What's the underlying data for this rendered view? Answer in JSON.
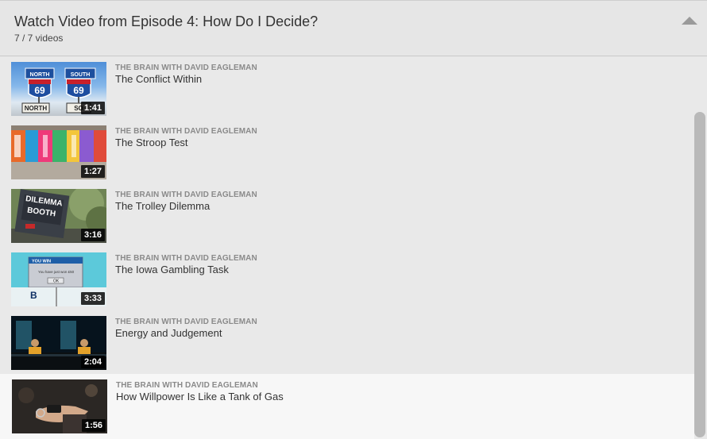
{
  "header": {
    "title": "Watch Video from Episode 4: How Do I Decide?",
    "count": "7 / 7 videos"
  },
  "videos": [
    {
      "channel": "THE BRAIN WITH DAVID EAGLEMAN",
      "title": "The Conflict Within",
      "duration": "1:41"
    },
    {
      "channel": "THE BRAIN WITH DAVID EAGLEMAN",
      "title": "The Stroop Test",
      "duration": "1:27"
    },
    {
      "channel": "THE BRAIN WITH DAVID EAGLEMAN",
      "title": "The Trolley Dilemma",
      "duration": "3:16"
    },
    {
      "channel": "THE BRAIN WITH DAVID EAGLEMAN",
      "title": "The Iowa Gambling Task",
      "duration": "3:33"
    },
    {
      "channel": "THE BRAIN WITH DAVID EAGLEMAN",
      "title": "Energy and Judgement",
      "duration": "2:04"
    },
    {
      "channel": "THE BRAIN WITH DAVID EAGLEMAN",
      "title": "How Willpower Is Like a Tank of Gas",
      "duration": "1:56"
    }
  ],
  "thumbs": {
    "t1": {
      "north": "NORTH",
      "south": "SOUTH",
      "num": "69",
      "num2": "69",
      "plate": "NORTH",
      "plate2": "SO"
    },
    "t3": {
      "line1": "DILEMMA",
      "line2": "BOOTH"
    },
    "t4": {
      "bar": "YOU WIN",
      "msg": "You have just won £50",
      "ok": "OK",
      "letter": "B"
    }
  },
  "colors": {
    "active_row": "#f7f7f7",
    "panel": "#e9e9e9",
    "accent_blue": "#1e5fa8"
  }
}
